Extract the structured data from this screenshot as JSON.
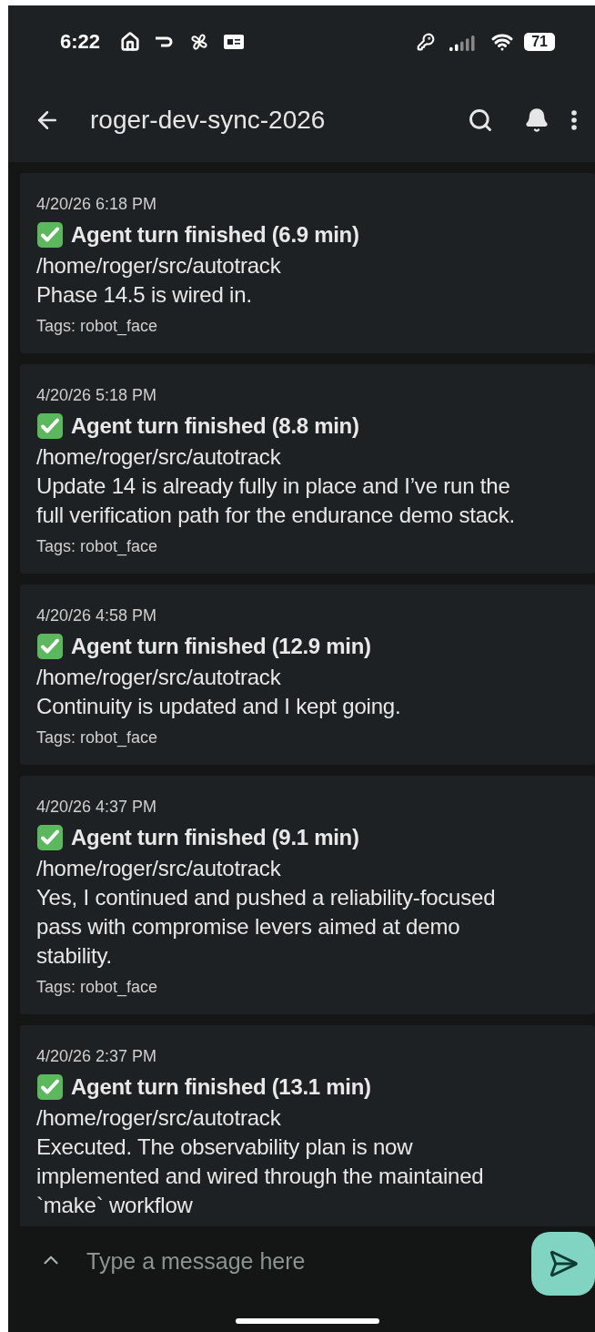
{
  "status_bar": {
    "time": "6:22",
    "battery": "71"
  },
  "app_bar": {
    "title": "roger-dev-sync-2026"
  },
  "messages": [
    {
      "timestamp": "4/20/26 6:18 PM",
      "title": "Agent turn finished (6.9 min)",
      "path": "/home/roger/src/autotrack",
      "body": "Phase 14.5 is wired in.",
      "tags": "Tags: robot_face"
    },
    {
      "timestamp": "4/20/26 5:18 PM",
      "title": "Agent turn finished (8.8 min)",
      "path": "/home/roger/src/autotrack",
      "body": "Update 14 is already fully in place and I’ve run the full verification path for the endurance demo stack.",
      "tags": "Tags: robot_face"
    },
    {
      "timestamp": "4/20/26 4:58 PM",
      "title": "Agent turn finished (12.9 min)",
      "path": "/home/roger/src/autotrack",
      "body": "Continuity is updated and I kept going.",
      "tags": "Tags: robot_face"
    },
    {
      "timestamp": "4/20/26 4:37 PM",
      "title": "Agent turn finished (9.1 min)",
      "path": "/home/roger/src/autotrack",
      "body": "Yes, I continued and pushed a reliability-focused pass with compromise levers aimed at demo stability.",
      "tags": "Tags: robot_face"
    },
    {
      "timestamp": "4/20/26 2:37 PM",
      "title": "Agent turn finished (13.1 min)",
      "path": "/home/roger/src/autotrack",
      "body": "Executed. The observability plan is now implemented and wired through the maintained `make` workflow"
    }
  ],
  "composer": {
    "placeholder": "Type a message here"
  }
}
